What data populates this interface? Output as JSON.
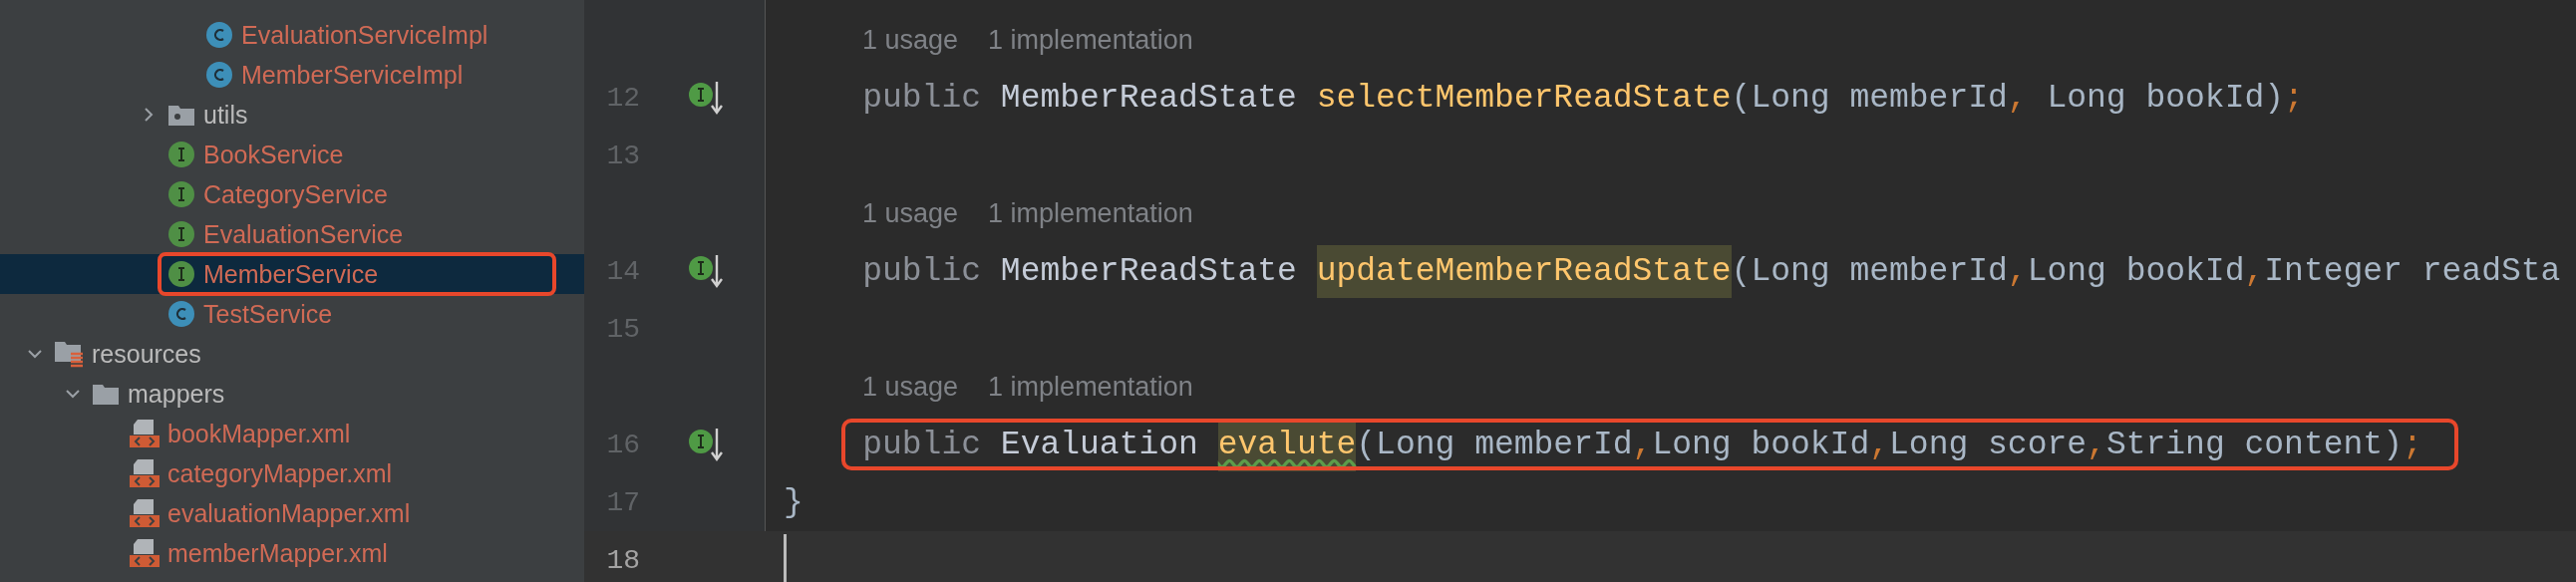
{
  "project_tree": [
    {
      "kind": "group",
      "children": [
        {
          "kind": "group",
          "children": [
            {
              "kind": "group",
              "children": [
                {
                  "kind": "group",
                  "children": [
                    {
                      "kind": "class",
                      "name": "EvaluationServiceImpl",
                      "selected": false,
                      "outlined": false
                    },
                    {
                      "kind": "class",
                      "name": "MemberServiceImpl",
                      "selected": false,
                      "outlined": false
                    }
                  ]
                },
                {
                  "kind": "package",
                  "name": "utils",
                  "expanded": false,
                  "selected": false,
                  "outlined": false
                },
                {
                  "kind": "interface",
                  "name": "BookService",
                  "selected": false,
                  "outlined": false
                },
                {
                  "kind": "interface",
                  "name": "CategoryService",
                  "selected": false,
                  "outlined": false
                },
                {
                  "kind": "interface",
                  "name": "EvaluationService",
                  "selected": false,
                  "outlined": false
                },
                {
                  "kind": "interface",
                  "name": "MemberService",
                  "selected": true,
                  "outlined": true
                },
                {
                  "kind": "class",
                  "name": "TestService",
                  "selected": false,
                  "outlined": false
                }
              ]
            }
          ]
        }
      ]
    },
    {
      "kind": "resources",
      "name": "resources",
      "expanded": true,
      "selected": false,
      "outlined": false,
      "children": [
        {
          "kind": "folder",
          "name": "mappers",
          "expanded": true,
          "selected": false,
          "outlined": false,
          "children": [
            {
              "kind": "xml",
              "name": "bookMapper.xml",
              "selected": false,
              "outlined": false
            },
            {
              "kind": "xml",
              "name": "categoryMapper.xml",
              "selected": false,
              "outlined": false
            },
            {
              "kind": "xml",
              "name": "evaluationMapper.xml",
              "selected": false,
              "outlined": false
            },
            {
              "kind": "xml",
              "name": "memberMapper.xml",
              "selected": false,
              "outlined": false
            }
          ]
        }
      ]
    }
  ],
  "editor_lines": [
    {
      "kind": "hint",
      "usages": "1 usage",
      "implementations": "1 implementation"
    },
    {
      "kind": "code",
      "number": "12",
      "gutter_icon": true,
      "current": false,
      "outlined": false,
      "tokens": [
        {
          "kind": "keyword",
          "text": "    public"
        },
        {
          "kind": "type",
          "text": " MemberReadState "
        },
        {
          "kind": "method",
          "text": "selectMemberReadState",
          "highlighted": false,
          "warning": false
        },
        {
          "kind": "plain",
          "text": "(Long memberId"
        },
        {
          "kind": "separator",
          "text": ","
        },
        {
          "kind": "plain",
          "text": " Long bookId)"
        },
        {
          "kind": "separator",
          "text": ";"
        }
      ]
    },
    {
      "kind": "code",
      "number": "13",
      "gutter_icon": false,
      "current": false,
      "outlined": false
    },
    {
      "kind": "hint",
      "usages": "1 usage",
      "implementations": "1 implementation"
    },
    {
      "kind": "code",
      "number": "14",
      "gutter_icon": true,
      "current": false,
      "outlined": false,
      "tokens": [
        {
          "kind": "keyword",
          "text": "    public"
        },
        {
          "kind": "type",
          "text": " MemberReadState "
        },
        {
          "kind": "method",
          "text": "updateMemberReadState",
          "highlighted": true,
          "warning": false
        },
        {
          "kind": "plain",
          "text": "(Long memberId"
        },
        {
          "kind": "separator",
          "text": ","
        },
        {
          "kind": "plain",
          "text": "Long bookId"
        },
        {
          "kind": "separator",
          "text": ","
        },
        {
          "kind": "plain",
          "text": "Integer readSta"
        }
      ]
    },
    {
      "kind": "code",
      "number": "15",
      "gutter_icon": false,
      "current": false,
      "outlined": false
    },
    {
      "kind": "hint",
      "usages": "1 usage",
      "implementations": "1 implementation"
    },
    {
      "kind": "code",
      "number": "16",
      "gutter_icon": true,
      "current": false,
      "outlined": true,
      "tokens": [
        {
          "kind": "keyword",
          "text": "    public"
        },
        {
          "kind": "type",
          "text": " Evaluation "
        },
        {
          "kind": "method",
          "text": "evalute",
          "highlighted": true,
          "warning": true
        },
        {
          "kind": "plain",
          "text": "(Long memberId"
        },
        {
          "kind": "separator",
          "text": ","
        },
        {
          "kind": "plain",
          "text": "Long bookId"
        },
        {
          "kind": "separator",
          "text": ","
        },
        {
          "kind": "plain",
          "text": "Long score"
        },
        {
          "kind": "separator",
          "text": ","
        },
        {
          "kind": "plain",
          "text": "String content)"
        },
        {
          "kind": "separator",
          "text": ";"
        }
      ]
    },
    {
      "kind": "code",
      "number": "17",
      "gutter_icon": false,
      "current": false,
      "outlined": false,
      "tokens": [
        {
          "kind": "plain",
          "text": "}"
        }
      ]
    },
    {
      "kind": "code",
      "number": "18",
      "gutter_icon": false,
      "current": true,
      "outlined": false
    }
  ]
}
